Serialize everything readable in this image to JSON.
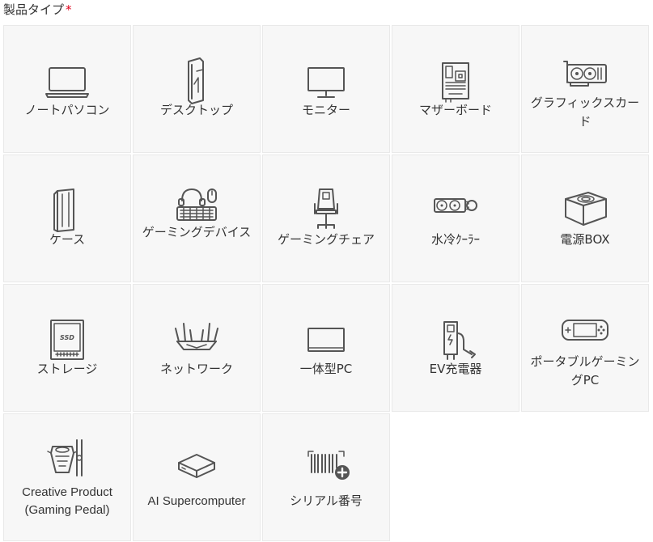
{
  "header": {
    "title": "製品タイプ",
    "required_mark": "*"
  },
  "products": [
    {
      "label": "ノートパソコン",
      "icon": "laptop-icon"
    },
    {
      "label": "デスクトップ",
      "icon": "desktop-tower-icon"
    },
    {
      "label": "モニター",
      "icon": "monitor-icon"
    },
    {
      "label": "マザーボード",
      "icon": "motherboard-icon"
    },
    {
      "label": "グラフィックスカード",
      "icon": "graphics-card-icon"
    },
    {
      "label": "ケース",
      "icon": "pc-case-icon"
    },
    {
      "label": "ゲーミングデバイス",
      "icon": "gaming-device-icon"
    },
    {
      "label": "ゲーミングチェア",
      "icon": "gaming-chair-icon"
    },
    {
      "label": "水冷ｸｰﾗｰ",
      "icon": "liquid-cooler-icon"
    },
    {
      "label": "電源BOX",
      "icon": "power-supply-icon"
    },
    {
      "label": "ストレージ",
      "icon": "ssd-icon"
    },
    {
      "label": "ネットワーク",
      "icon": "router-icon"
    },
    {
      "label": "一体型PC",
      "icon": "all-in-one-pc-icon"
    },
    {
      "label": "EV充電器",
      "icon": "ev-charger-icon"
    },
    {
      "label": "ポータブルゲーミングPC",
      "icon": "handheld-gaming-pc-icon"
    },
    {
      "label": "Creative Product (Gaming Pedal)",
      "icon": "gaming-pedal-icon"
    },
    {
      "label": "AI Supercomputer",
      "icon": "ai-supercomputer-icon"
    },
    {
      "label": "シリアル番号",
      "icon": "serial-number-icon"
    }
  ],
  "colors": {
    "tile_bg": "#f7f7f7",
    "tile_border": "#e9e9e9",
    "icon": "#555555",
    "required": "#e0001b"
  }
}
